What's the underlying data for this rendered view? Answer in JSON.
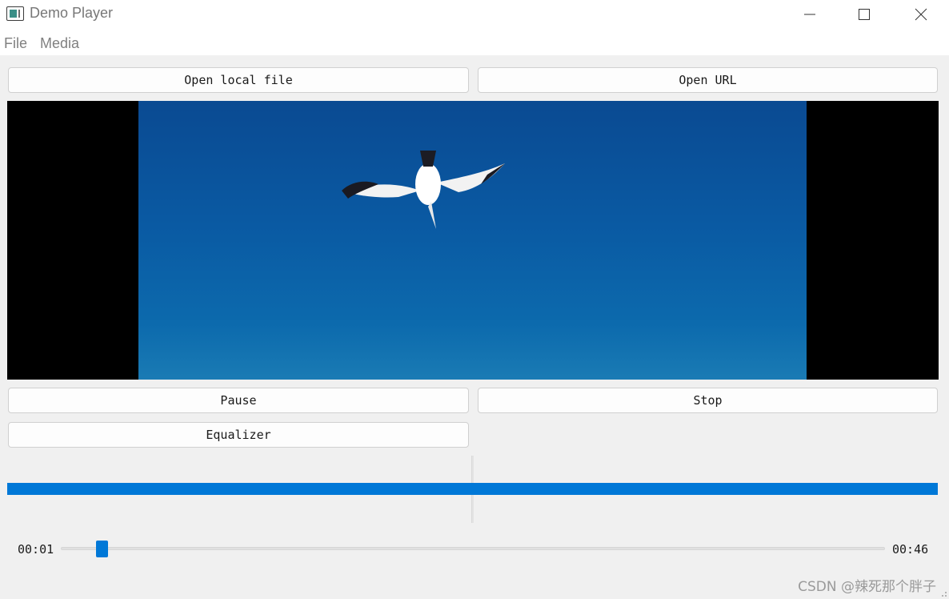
{
  "window": {
    "title": "Demo Player"
  },
  "menu": {
    "items": [
      "File",
      "Media"
    ]
  },
  "buttons": {
    "open_local": "Open local file",
    "open_url": "Open URL",
    "pause": "Pause",
    "stop": "Stop",
    "equalizer": "Equalizer"
  },
  "progress": {
    "value": 1.0
  },
  "playback": {
    "current_time": "00:01",
    "total_time": "00:46",
    "position_fraction": 0.043
  },
  "watermark": "CSDN @辣死那个胖子",
  "colors": {
    "accent": "#0078d7",
    "video_sky": "#0a5aa3"
  },
  "icons": [
    "app-icon",
    "minimize-icon",
    "maximize-icon",
    "close-icon",
    "resize-grip-icon"
  ]
}
